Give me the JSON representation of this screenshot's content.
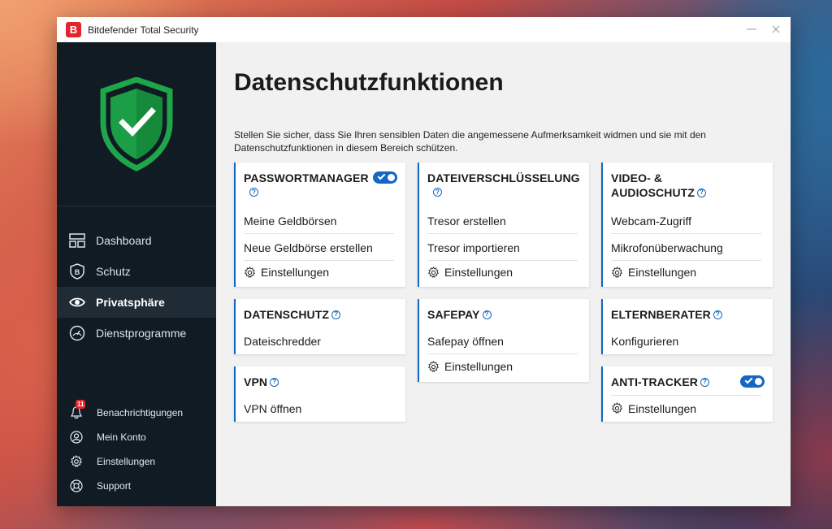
{
  "window": {
    "title": "Bitdefender Total Security",
    "logo_letter": "B"
  },
  "sidebar": {
    "nav": [
      {
        "label": "Dashboard",
        "icon": "dashboard-icon"
      },
      {
        "label": "Schutz",
        "icon": "protection-shield-icon"
      },
      {
        "label": "Privatsphäre",
        "icon": "eye-icon",
        "active": true
      },
      {
        "label": "Dienstprogramme",
        "icon": "gauge-icon"
      }
    ],
    "bottom": [
      {
        "label": "Benachrichtigungen",
        "icon": "bell-icon",
        "badge": "11"
      },
      {
        "label": "Mein Konto",
        "icon": "account-icon"
      },
      {
        "label": "Einstellungen",
        "icon": "gear-icon"
      },
      {
        "label": "Support",
        "icon": "support-lifebuoy-icon"
      }
    ]
  },
  "main": {
    "title": "Datenschutzfunktionen",
    "description": "Stellen Sie sicher, dass Sie Ihren sensiblen Daten die angemessene Aufmerksamkeit widmen und sie mit den Datenschutzfunktionen in diesem Bereich schützen.",
    "cards": {
      "passwortmanager": {
        "title": "PASSWORTMANAGER",
        "toggle_on": true,
        "items": [
          "Meine Geldbörsen",
          "Neue Geldbörse erstellen"
        ],
        "settings": "Einstellungen"
      },
      "dateiverschluesselung": {
        "title": "DATEIVERSCHLÜSSELUNG",
        "items": [
          "Tresor erstellen",
          "Tresor importieren"
        ],
        "settings": "Einstellungen"
      },
      "video_audio": {
        "title_line1": "VIDEO- &",
        "title_line2": "AUDIOSCHUTZ",
        "items": [
          "Webcam-Zugriff",
          "Mikrofonüberwachung"
        ],
        "settings": "Einstellungen"
      },
      "datenschutz": {
        "title": "DATENSCHUTZ",
        "items": [
          "Dateischredder"
        ]
      },
      "safepay": {
        "title": "SAFEPAY",
        "items": [
          "Safepay öffnen"
        ],
        "settings": "Einstellungen"
      },
      "elternberater": {
        "title": "ELTERNBERATER",
        "items": [
          "Konfigurieren"
        ]
      },
      "vpn": {
        "title": "VPN",
        "items": [
          "VPN öffnen"
        ]
      },
      "antitracker": {
        "title": "ANTI-TRACKER",
        "toggle_on": true,
        "settings": "Einstellungen"
      }
    },
    "help_glyph": "?"
  },
  "colors": {
    "accent": "#1467c2",
    "sidebar_bg": "#111b24",
    "shield_green": "#1fa64a",
    "brand_red": "#e4242b"
  }
}
